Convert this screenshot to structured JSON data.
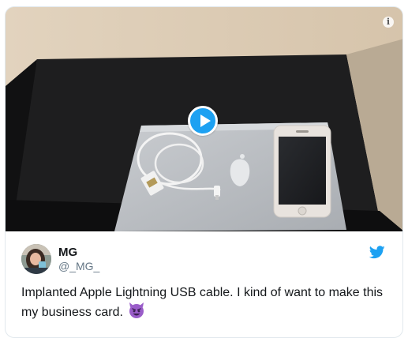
{
  "media": {
    "play_icon": "play-icon",
    "info_icon": "info-icon",
    "info_glyph": "i"
  },
  "user": {
    "display_name": "MG",
    "handle": "@_MG_",
    "avatar": "avatar"
  },
  "brand_icon": "twitter-bird-icon",
  "tweet": {
    "text": "Implanted Apple Lightning USB cable. I kind of want to make this my business card.",
    "emoji": "smiling-imp-emoji"
  },
  "colors": {
    "accent": "#1da1f2",
    "text": "#14171a",
    "muted": "#657786",
    "border": "#e1e8ed",
    "emoji_purple": "#9a5dc9"
  }
}
